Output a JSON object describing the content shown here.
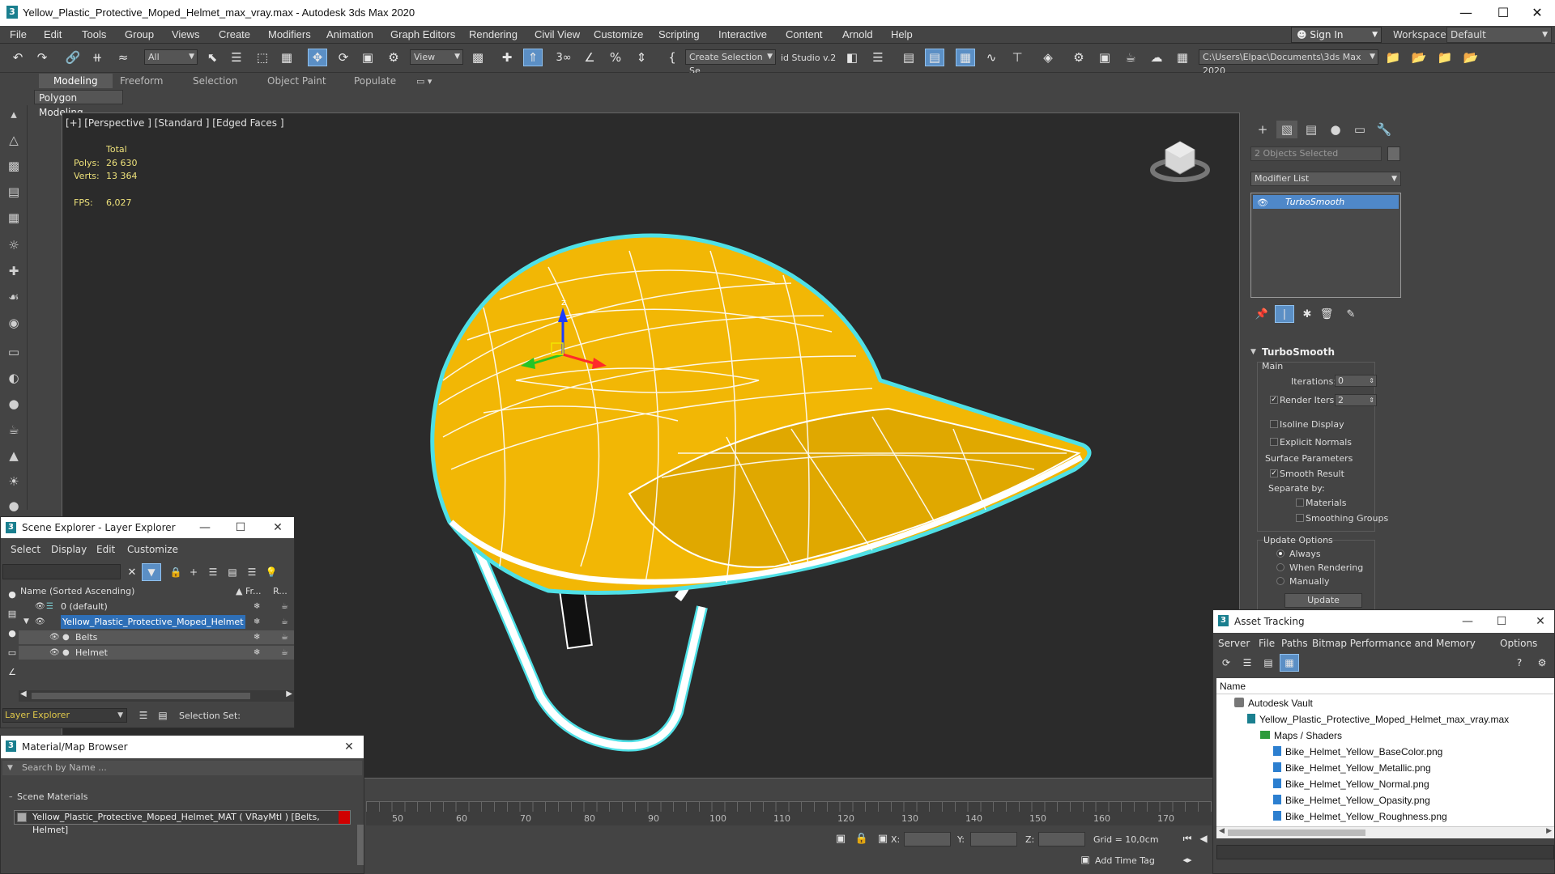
{
  "window": {
    "title": "Yellow_Plastic_Protective_Moped_Helmet_max_vray.max - Autodesk 3ds Max 2020",
    "app_icon": "3"
  },
  "menus": [
    "File",
    "Edit",
    "Tools",
    "Group",
    "Views",
    "Create",
    "Modifiers",
    "Animation",
    "Graph Editors",
    "Rendering",
    "Civil View",
    "Customize",
    "Scripting",
    "Interactive",
    "Content",
    "Arnold",
    "Help"
  ],
  "account": {
    "sign_in": "Sign In",
    "workspaces_label": "Workspaces:",
    "workspaces_value": "Default"
  },
  "toolbar": {
    "filter": "All",
    "ref_coord": "View",
    "selection_set": "Create Selection Se",
    "studio": "id Studio v.2",
    "project_path": "C:\\Users\\Elpac\\Documents\\3ds Max 2020"
  },
  "ribbon": {
    "tabs": [
      "Modeling",
      "Freeform",
      "Selection",
      "Object Paint",
      "Populate"
    ],
    "active": "Modeling",
    "sub": "Polygon Modeling"
  },
  "viewport": {
    "label": "[+] [Perspective ] [Standard ] [Edged Faces ]",
    "stats": {
      "total_label": "Total",
      "polys_label": "Polys:",
      "polys": "26 630",
      "verts_label": "Verts:",
      "verts": "13 364",
      "fps_label": "FPS:",
      "fps": "6,027"
    },
    "gizmo": {
      "z": "z"
    },
    "colors": {
      "helmet": "#f2b705",
      "wire": "#ffffff",
      "selection": "#4fe0e6"
    }
  },
  "command_panel": {
    "objects_selected": "2 Objects Selected",
    "modifier_list": "Modifier List",
    "stack_item": "TurboSmooth",
    "rollout": "TurboSmooth",
    "main": "Main",
    "iterations_label": "Iterations:",
    "iterations": "0",
    "render_iters_label": "Render Iters:",
    "render_iters": "2",
    "render_iters_checked": true,
    "isoline": "Isoline Display",
    "explicit_normals": "Explicit Normals",
    "surface_params": "Surface Parameters",
    "smooth_result": "Smooth Result",
    "separate_by": "Separate by:",
    "materials": "Materials",
    "smoothing_groups": "Smoothing Groups",
    "update_options": "Update Options",
    "always": "Always",
    "when_rendering": "When Rendering",
    "manually": "Manually",
    "update_button": "Update"
  },
  "scene_explorer": {
    "title": "Scene Explorer - Layer Explorer",
    "menus": [
      "Select",
      "Display",
      "Edit",
      "Customize"
    ],
    "col_name": "Name (Sorted Ascending)",
    "col_fr": "▲ Fr...",
    "col_r": "R...",
    "rows": [
      {
        "name": "0 (default)"
      },
      {
        "name": "Yellow_Plastic_Protective_Moped_Helmet"
      },
      {
        "name": "Belts"
      },
      {
        "name": "Helmet"
      }
    ],
    "footer_combo": "Layer Explorer",
    "selection_set": "Selection Set:"
  },
  "material_browser": {
    "title": "Material/Map Browser",
    "search_placeholder": "Search by Name ...",
    "section": "Scene Materials",
    "item": "Yellow_Plastic_Protective_Moped_Helmet_MAT ( VRayMtl ) [Belts, Helmet]"
  },
  "timeline": {
    "ticks": [
      "50",
      "60",
      "70",
      "80",
      "90",
      "100",
      "110",
      "120",
      "130",
      "140",
      "150",
      "160",
      "170"
    ]
  },
  "statusbar": {
    "x_label": "X:",
    "y_label": "Y:",
    "z_label": "Z:",
    "grid": "Grid = 10,0cm",
    "add_time_tag": "Add Time Tag"
  },
  "asset_tracking": {
    "title": "Asset Tracking",
    "menus": [
      "Server",
      "File",
      "Paths",
      "Bitmap Performance and Memory",
      "Options"
    ],
    "col_name": "Name",
    "rows": [
      {
        "name": "Autodesk Vault"
      },
      {
        "name": "Yellow_Plastic_Protective_Moped_Helmet_max_vray.max"
      },
      {
        "name": "Maps / Shaders"
      },
      {
        "name": "Bike_Helmet_Yellow_BaseColor.png"
      },
      {
        "name": "Bike_Helmet_Yellow_Metallic.png"
      },
      {
        "name": "Bike_Helmet_Yellow_Normal.png"
      },
      {
        "name": "Bike_Helmet_Yellow_Opasity.png"
      },
      {
        "name": "Bike_Helmet_Yellow_Roughness.png"
      }
    ]
  }
}
